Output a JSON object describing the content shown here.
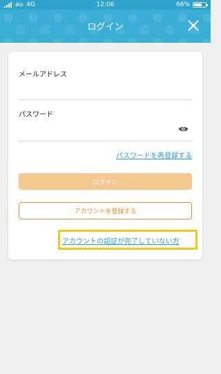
{
  "status_bar": {
    "carrier": "au",
    "network": "4G",
    "time": "12:06",
    "battery_text": "66%",
    "battery_level": 0.66
  },
  "header": {
    "title": "ログイン",
    "close_icon": "close-icon"
  },
  "form": {
    "email_label": "メールアドレス",
    "email_value": "",
    "password_label": "パスワード",
    "password_value": "",
    "password_visibility_icon": "eye-icon",
    "reset_password_link": "パスワードを再登録する",
    "login_button": "ログイン",
    "register_button": "アカウントを登録する",
    "unverified_link": "アカウントの認証が完了していない方"
  },
  "colors": {
    "header_bg": "#3aaed6",
    "link": "#2b9bd3",
    "login_button_bg": "#f5c891",
    "register_border": "#e6892f",
    "highlight": "#f4c817"
  }
}
